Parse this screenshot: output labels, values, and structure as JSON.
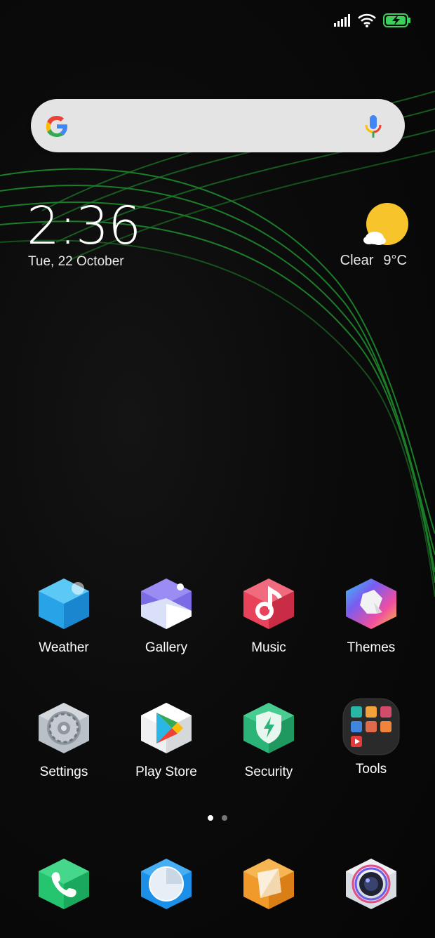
{
  "status_bar": {
    "signal_icon": "signal-bars-icon",
    "wifi_icon": "wifi-icon",
    "battery_icon": "battery-charging-icon"
  },
  "search": {
    "logo_icon": "google-g-icon",
    "mic_icon": "microphone-icon"
  },
  "clock": {
    "time": "2:36",
    "date": "Tue, 22 October"
  },
  "weather": {
    "icon": "partly-sunny-icon",
    "condition": "Clear",
    "temperature": "9°C"
  },
  "apps": [
    {
      "label": "Weather",
      "icon": "weather-app-icon"
    },
    {
      "label": "Gallery",
      "icon": "gallery-app-icon"
    },
    {
      "label": "Music",
      "icon": "music-app-icon"
    },
    {
      "label": "Themes",
      "icon": "themes-app-icon"
    },
    {
      "label": "Settings",
      "icon": "settings-app-icon"
    },
    {
      "label": "Play Store",
      "icon": "play-store-app-icon"
    },
    {
      "label": "Security",
      "icon": "security-app-icon"
    },
    {
      "label": "Tools",
      "icon": "tools-folder-icon"
    }
  ],
  "pages": {
    "count": 2,
    "current": 1
  },
  "dock": [
    {
      "icon": "phone-app-icon"
    },
    {
      "icon": "browser-app-icon"
    },
    {
      "icon": "file-manager-app-icon"
    },
    {
      "icon": "camera-app-icon"
    }
  ],
  "colors": {
    "accent_green": "#2bb24c",
    "background": "#0b0b0b",
    "search_bg": "#e4e4e4",
    "sun_yellow": "#f7c52b"
  }
}
